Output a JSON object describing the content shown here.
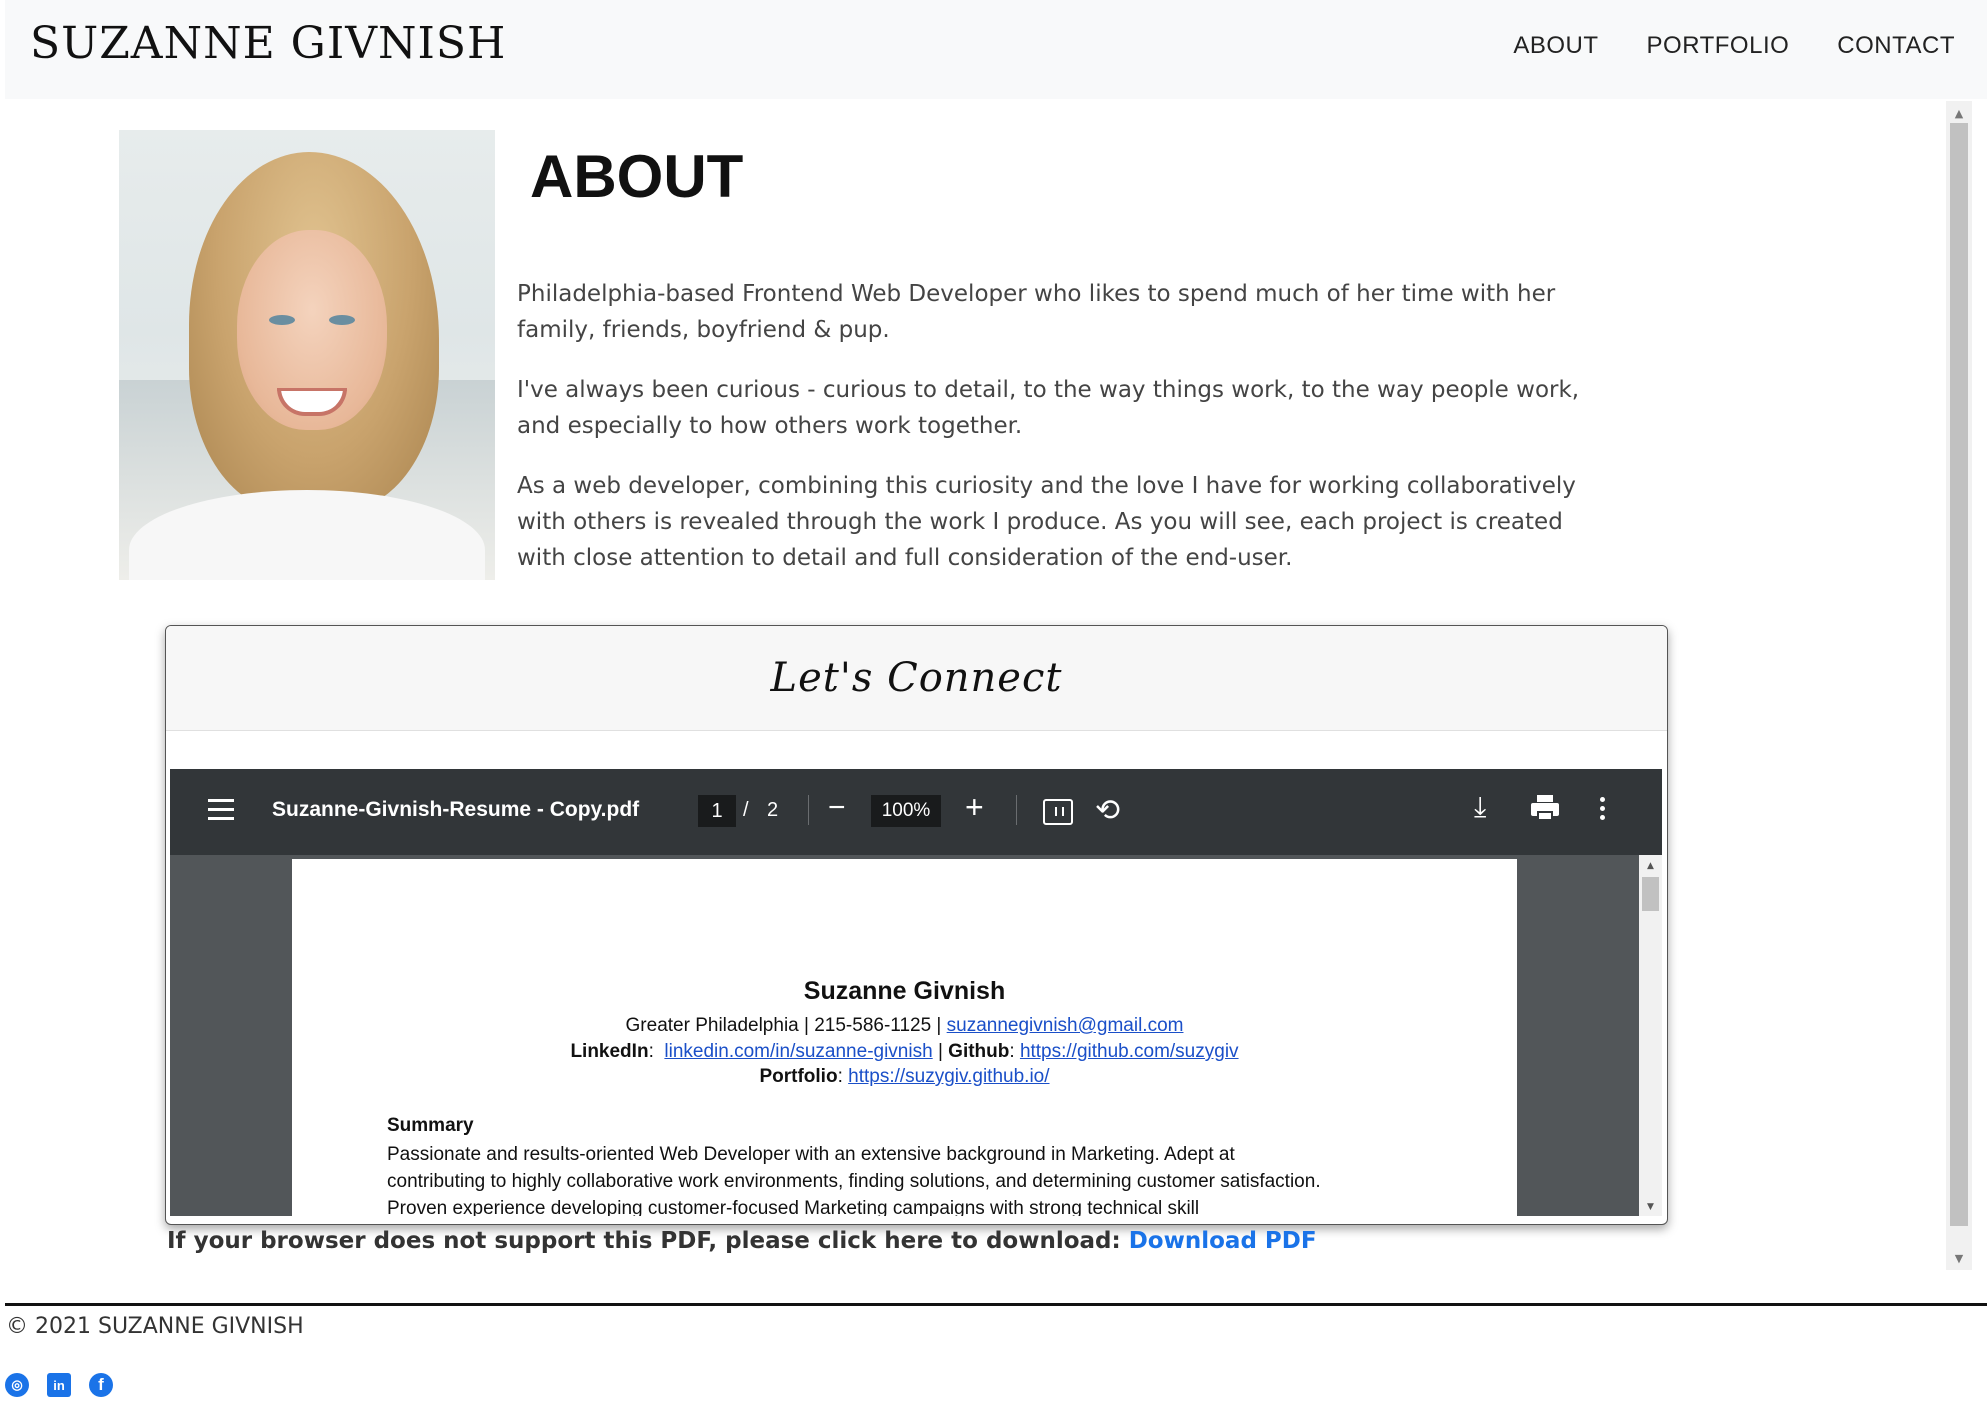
{
  "header": {
    "brand": "SUZANNE GIVNISH",
    "nav": [
      "ABOUT",
      "PORTFOLIO",
      "CONTACT"
    ]
  },
  "about": {
    "title": "ABOUT",
    "paragraphs": [
      "Philadelphia-based Frontend Web Developer who likes to spend much of her time with her family, friends, boyfriend & pup.",
      "I've always been curious - curious to detail, to the way things work, to the way people work, and especially to how others work together.",
      "As a web developer, combining this curiosity and the love I have for working collaboratively with others is revealed through the work I produce. As you will see, each project is created with close attention to detail and full consideration of the end-user."
    ]
  },
  "connect": {
    "title": "Let's Connect"
  },
  "pdf_viewer": {
    "file_name": "Suzanne-Givnish-Resume - Copy.pdf",
    "current_page": "1",
    "page_separator": "/",
    "total_pages": "2",
    "zoom": "100%",
    "icons": [
      "menu-icon",
      "zoom-out-icon",
      "zoom-in-icon",
      "fit-page-icon",
      "rotate-icon",
      "download-icon",
      "print-icon",
      "more-options-icon"
    ]
  },
  "resume": {
    "name": "Suzanne Givnish",
    "contact_text": "Greater Philadelphia | 215-586-1125 | ",
    "email": "suzannegivnish@gmail.com",
    "linkedin_label": "LinkedIn",
    "linkedin_url": "linkedin.com/in/suzanne-givnish",
    "github_label": "Github",
    "github_url": "https://github.com/suzygiv",
    "portfolio_label": "Portfolio",
    "portfolio_url": "https://suzygiv.github.io/",
    "summary_heading": "Summary",
    "summary_text": "Passionate and results-oriented Web Developer with an extensive background in Marketing. Adept at contributing to highly collaborative work environments, finding solutions, and determining customer satisfaction. Proven experience developing customer-focused Marketing campaigns with strong technical skill"
  },
  "fallback": {
    "text": "If your browser does not support this PDF, please click here to download: ",
    "link": "Download PDF"
  },
  "footer": {
    "copyright": "© 2021 SUZANNE GIVNISH",
    "social_icons": [
      "github-icon",
      "linkedin-icon",
      "facebook-icon"
    ]
  },
  "colors": {
    "link": "#1a73e8",
    "pdf_toolbar": "#323639",
    "pdf_background": "#525659",
    "header_bg": "#f8f9fa"
  }
}
